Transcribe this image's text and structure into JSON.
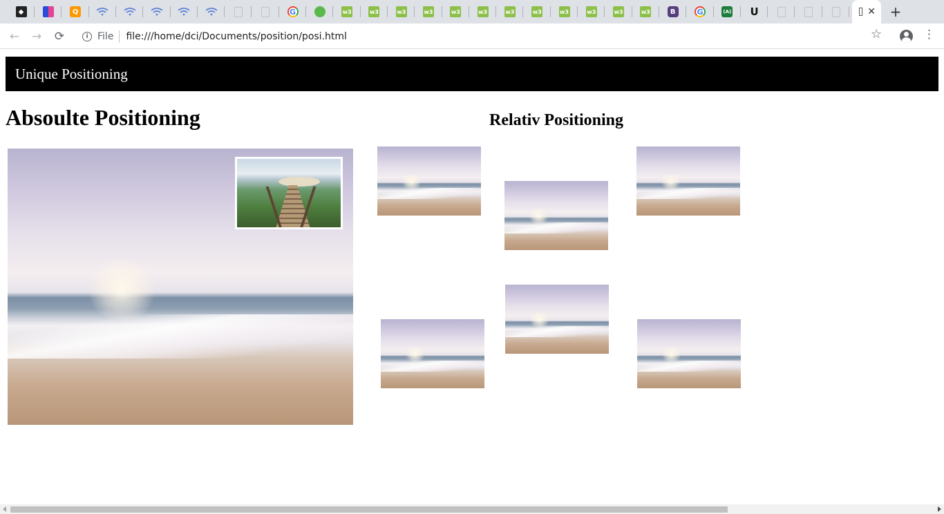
{
  "browser": {
    "tabs": [
      {
        "icon": "kodi-icon"
      },
      {
        "icon": "colorful-tiles-icon"
      },
      {
        "icon": "orange-search-icon"
      },
      {
        "icon": "wifi-icon"
      },
      {
        "icon": "wifi-icon"
      },
      {
        "icon": "wifi-icon"
      },
      {
        "icon": "wifi-icon"
      },
      {
        "icon": "wifi-icon"
      },
      {
        "icon": "blank-document-icon"
      },
      {
        "icon": "blank-document-icon"
      },
      {
        "icon": "google-icon"
      },
      {
        "icon": "frog-icon"
      },
      {
        "icon": "w3schools-icon"
      },
      {
        "icon": "w3schools-icon"
      },
      {
        "icon": "w3schools-icon"
      },
      {
        "icon": "w3schools-icon"
      },
      {
        "icon": "w3schools-icon"
      },
      {
        "icon": "w3schools-icon"
      },
      {
        "icon": "w3schools-icon"
      },
      {
        "icon": "w3schools-icon"
      },
      {
        "icon": "w3schools-icon"
      },
      {
        "icon": "w3schools-icon"
      },
      {
        "icon": "w3schools-icon"
      },
      {
        "icon": "w3schools-icon"
      },
      {
        "icon": "bootstrap-icon"
      },
      {
        "icon": "google-icon"
      },
      {
        "icon": "android-icon"
      },
      {
        "icon": "udemy-icon"
      },
      {
        "icon": "blank-document-icon"
      },
      {
        "icon": "blank-document-icon"
      },
      {
        "icon": "blank-document-icon"
      }
    ],
    "active_tab": {
      "icon": "document-icon",
      "close": "✕"
    },
    "new_tab": "+",
    "nav": {
      "back": "←",
      "forward": "→",
      "reload": "⟳"
    },
    "omnibox": {
      "info": "i",
      "scheme_label": "File",
      "url": "file:///home/dci/Documents/position/posi.html"
    },
    "bookmark": "☆",
    "menu": "⋮"
  },
  "page": {
    "banner": "Unique Positioning",
    "absolute_heading": "Absoulte Positioning",
    "relative_heading": "Relativ Positioning",
    "images": {
      "big": "beach-image",
      "overlay": "boardwalk-stairs-image",
      "relative_count": 6
    }
  },
  "scrollbar": {
    "horizontal_visible_fraction": 0.77
  }
}
